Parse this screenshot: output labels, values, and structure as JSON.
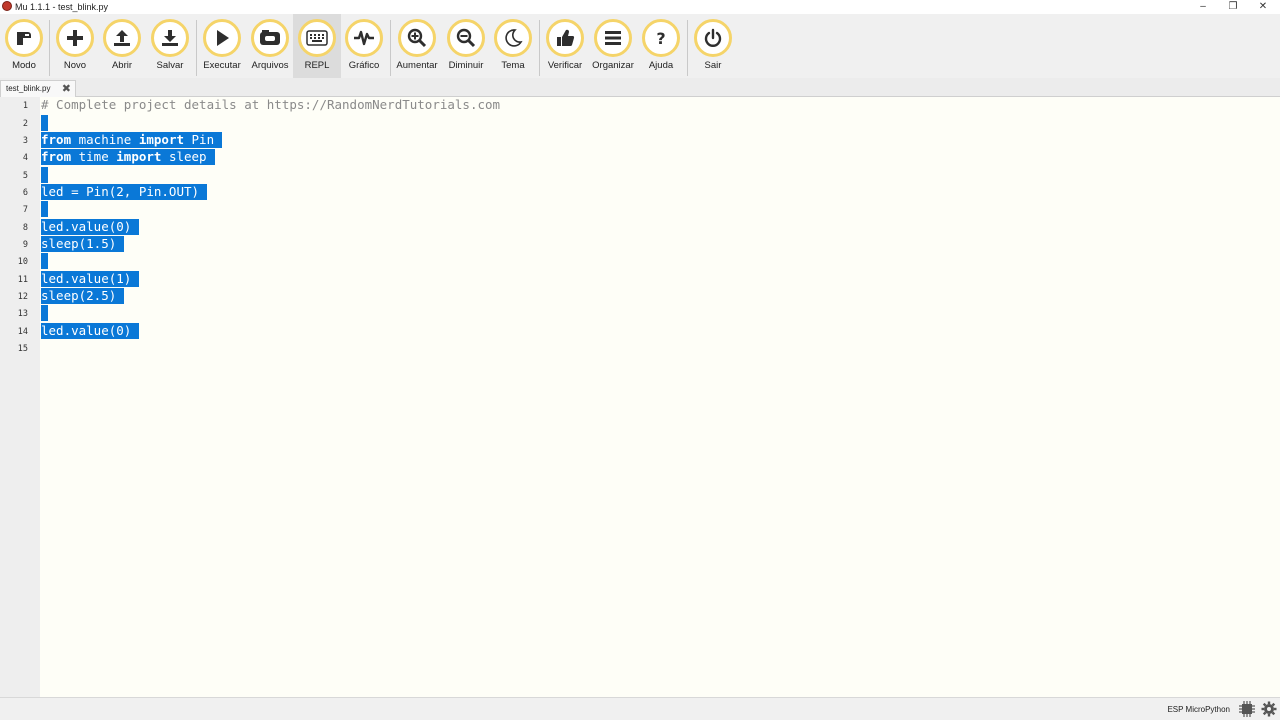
{
  "window": {
    "title": "Mu 1.1.1 - test_blink.py"
  },
  "toolbar": {
    "buttons": [
      {
        "label": "Modo",
        "icon": "mode-icon"
      },
      {
        "label": "Novo",
        "icon": "plus-icon"
      },
      {
        "label": "Abrir",
        "icon": "upload-icon"
      },
      {
        "label": "Salvar",
        "icon": "download-icon"
      },
      {
        "label": "Executar",
        "icon": "play-icon"
      },
      {
        "label": "Arquivos",
        "icon": "files-icon"
      },
      {
        "label": "REPL",
        "icon": "keyboard-icon"
      },
      {
        "label": "Gráfico",
        "icon": "pulse-icon"
      },
      {
        "label": "Aumentar",
        "icon": "zoom-in-icon"
      },
      {
        "label": "Diminuir",
        "icon": "zoom-out-icon"
      },
      {
        "label": "Tema",
        "icon": "moon-icon"
      },
      {
        "label": "Verificar",
        "icon": "thumbs-up-icon"
      },
      {
        "label": "Organizar",
        "icon": "lines-icon"
      },
      {
        "label": "Ajuda",
        "icon": "question-icon"
      },
      {
        "label": "Sair",
        "icon": "power-icon"
      }
    ],
    "active": "REPL"
  },
  "tabs": [
    {
      "name": "test_blink.py",
      "close": "✖"
    }
  ],
  "editor": {
    "line_numbers": [
      "1",
      "2",
      "3",
      "4",
      "5",
      "6",
      "7",
      "8",
      "9",
      "10",
      "11",
      "12",
      "13",
      "14",
      "15"
    ],
    "comment": "# Complete project details at https://RandomNerdTutorials.com",
    "code": {
      "l3_kw1": "from",
      "l3_mid": " machine ",
      "l3_kw2": "import",
      "l3_end": " Pin",
      "l4_kw1": "from",
      "l4_mid": " time ",
      "l4_kw2": "import",
      "l4_end": " sleep",
      "l6": "led = Pin(2, Pin.OUT)",
      "l8": "led.value(0)",
      "l9": "sleep(1.5)",
      "l11": "led.value(1)",
      "l12": "sleep(2.5)",
      "l14": "led.value(0)"
    }
  },
  "colors": {
    "selection": "#0a78d7",
    "button_ring": "#f5d469",
    "editor_bg": "#fefef7"
  },
  "status": {
    "mode": "ESP MicroPython"
  }
}
